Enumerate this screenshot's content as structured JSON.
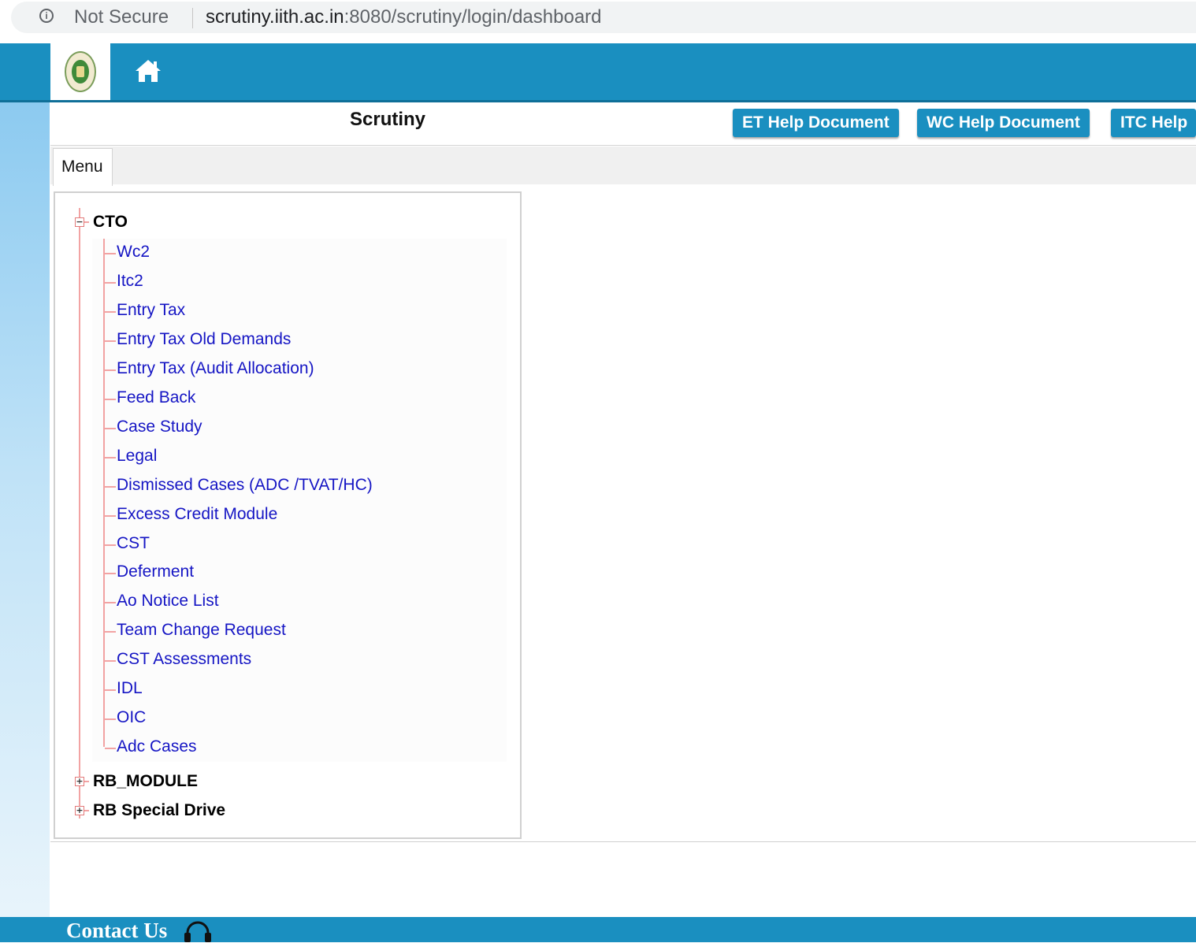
{
  "browser": {
    "security_label": "Not Secure",
    "url_host": "scrutiny.iith.ac.in",
    "url_path": ":8080/scrutiny/login/dashboard"
  },
  "header": {
    "logo_icon": "state-emblem-logo",
    "home_icon": "home-icon",
    "brand_color": "#1a8fc0"
  },
  "titlebar": {
    "title": "Scrutiny",
    "buttons": [
      {
        "label": "ET Help Document"
      },
      {
        "label": "WC Help Document"
      },
      {
        "label": "ITC Help"
      }
    ]
  },
  "tabs": [
    {
      "label": "Menu",
      "active": true
    }
  ],
  "tree": {
    "roots": [
      {
        "label": "CTO",
        "expanded": true,
        "children": [
          "Wc2",
          "Itc2",
          "Entry Tax",
          "Entry Tax Old Demands",
          "Entry Tax (Audit Allocation)",
          "Feed Back",
          "Case Study",
          "Legal",
          "Dismissed Cases (ADC /TVAT/HC)",
          "Excess Credit Module",
          "CST",
          "Deferment",
          "Ao Notice List",
          "Team Change Request",
          "CST Assessments",
          "IDL",
          "OIC",
          "Adc Cases"
        ]
      },
      {
        "label": "RB_MODULE",
        "expanded": false
      },
      {
        "label": "RB Special Drive",
        "expanded": false
      }
    ]
  },
  "footer": {
    "contact_label": "Contact Us",
    "contact_icon": "headset-icon"
  }
}
